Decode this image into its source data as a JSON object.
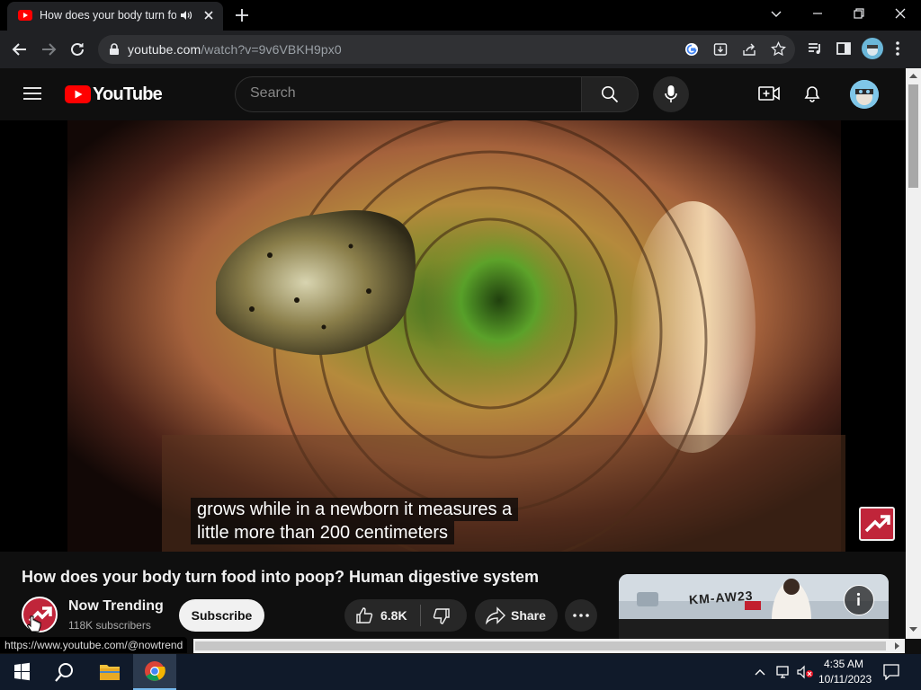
{
  "browser": {
    "tab_title": "How does your body turn food into poop? Human digestive system - YouTube",
    "url_host": "youtube.com",
    "url_path": "/watch?v=9v6VBKH9px0"
  },
  "youtube": {
    "logo_text": "YouTube",
    "search_placeholder": "Search"
  },
  "video": {
    "caption_line1": "grows while in a newborn it measures a",
    "caption_line2": "little more than 200 centimeters",
    "title": "How does your body turn food into poop? Human digestive system"
  },
  "channel": {
    "name": "Now Trending",
    "subscribers": "118K subscribers",
    "subscribe_label": "Subscribe"
  },
  "actions": {
    "like_count": "6.8K",
    "share_label": "Share"
  },
  "ad": {
    "image_text": "KM-AW23"
  },
  "status_bar": {
    "hover_url": "https://www.youtube.com/@nowtrend"
  },
  "taskbar": {
    "time": "4:35 AM",
    "date": "10/11/2023"
  },
  "colors": {
    "youtube_red": "#ff0000",
    "channel_brand": "#c0253a",
    "page_bg": "#0f0f0f"
  }
}
